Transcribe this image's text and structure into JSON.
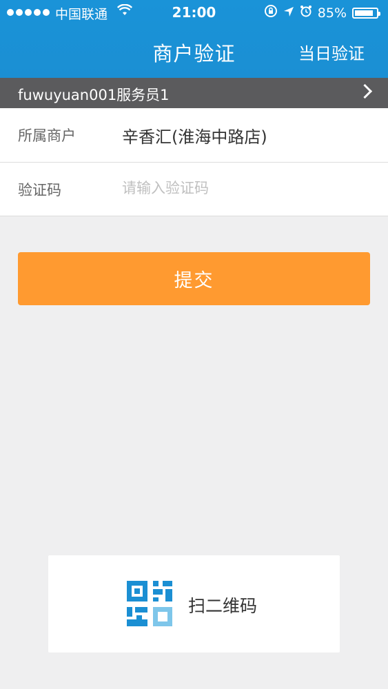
{
  "status_bar": {
    "carrier": "中国联通",
    "time": "21:00",
    "battery": "85%",
    "battery_level": 0.85,
    "icons": [
      "signal-dots-icon",
      "wifi-icon",
      "rotation-lock-icon",
      "location-arrow-icon",
      "alarm-icon",
      "battery-icon"
    ]
  },
  "nav": {
    "title": "商户验证",
    "right_action": "当日验证"
  },
  "staff": {
    "name": "fuwuyuan001服务员1"
  },
  "form": {
    "merchant_label": "所属商户",
    "merchant_value": "辛香汇(淮海中路店)",
    "code_label": "验证码",
    "code_placeholder": "请输入验证码",
    "code_value": ""
  },
  "submit_label": "提交",
  "scan": {
    "label": "扫二维码"
  },
  "colors": {
    "header": "#1a93d8",
    "staff_bar": "#5b5b5d",
    "submit": "#ff9a30",
    "qr_primary": "#1b8fd3",
    "qr_secondary": "#7ec6ea",
    "background": "#efeff0"
  }
}
